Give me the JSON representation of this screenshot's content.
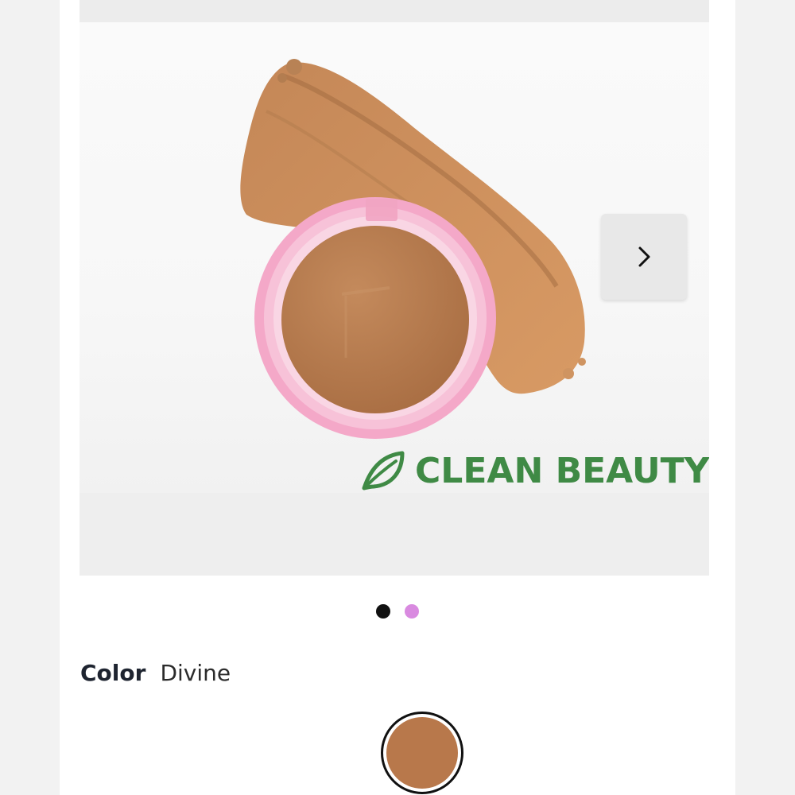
{
  "hero": {
    "image_alt_icon": "compact-powder-image",
    "next_icon": "chevron-right-icon",
    "badge": {
      "icon": "leaf-icon",
      "text": "CLEAN BEAUTY",
      "color": "#3f8a45"
    }
  },
  "carousel": {
    "slide_count": 2,
    "active_index": 0,
    "dot_colors": [
      "#111111",
      "#d98ae0"
    ]
  },
  "product": {
    "color_label": "Color",
    "color_value": "Divine",
    "swatch_color": "#b8784b",
    "compact_color": "#f4a8c8"
  }
}
